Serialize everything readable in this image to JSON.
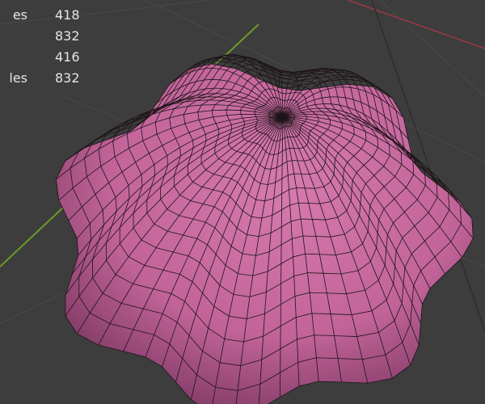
{
  "viewport": {
    "background": "#3d3d3d",
    "mesh_color": "#c2649a",
    "wire_color": "#1e1418",
    "y_axis_color": "#6b9a2a",
    "x_axis_color": "#9a3a45"
  },
  "stats": [
    {
      "label": "es",
      "value": "418"
    },
    {
      "label": "",
      "value": "832"
    },
    {
      "label": "",
      "value": "416"
    },
    {
      "label": "les",
      "value": "832"
    }
  ]
}
